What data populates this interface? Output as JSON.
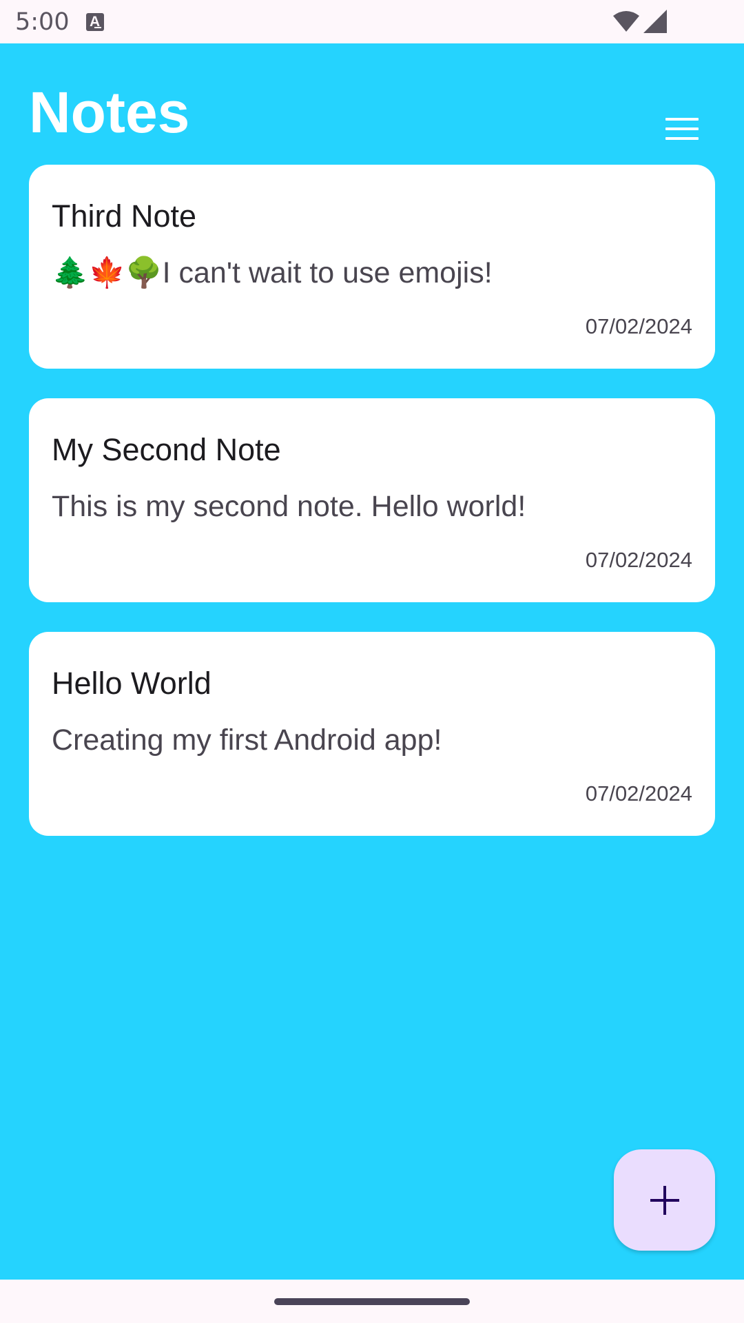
{
  "status_bar": {
    "time": "5:00",
    "icons": [
      "keyboard-a-icon",
      "wifi-icon",
      "cell-signal-icon"
    ]
  },
  "header": {
    "title": "Notes",
    "menu_icon": "hamburger-menu-icon"
  },
  "notes": [
    {
      "title": "Third Note",
      "body": "🌲🍁🌳I can't wait to use emojis!",
      "date": "07/02/2024"
    },
    {
      "title": "My Second Note",
      "body": "This is my second note. Hello world!",
      "date": "07/02/2024"
    },
    {
      "title": "Hello World",
      "body": "Creating my first Android app!",
      "date": "07/02/2024"
    }
  ],
  "fab": {
    "icon": "plus-icon"
  },
  "colors": {
    "background": "#25D3FE",
    "card": "#FFFFFF",
    "fab": "#EADDFE",
    "fab_icon": "#21005D",
    "system_bar": "#FEF7FB"
  }
}
